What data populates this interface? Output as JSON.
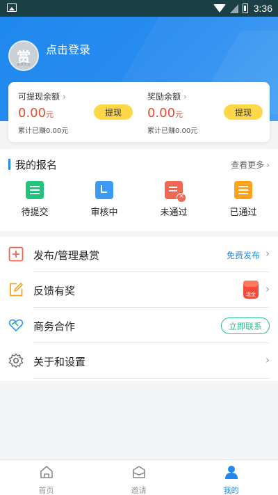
{
  "status_bar": {
    "time": "3:36"
  },
  "profile": {
    "avatar_text": "赏",
    "avatar_caption": "悬赏大全",
    "login_text": "点击登录"
  },
  "balances": [
    {
      "label": "可提现余额",
      "amount": "0.00",
      "unit": "元",
      "earned": "累计已赚0.00元",
      "button": "提现"
    },
    {
      "label": "奖励余额",
      "amount": "0.00",
      "unit": "元",
      "earned": "累计已赚0.00元",
      "button": "提现"
    }
  ],
  "signup": {
    "title": "我的报名",
    "more": "查看更多",
    "items": [
      {
        "label": "待提交"
      },
      {
        "label": "审核中"
      },
      {
        "label": "未通过"
      },
      {
        "label": "已通过"
      }
    ]
  },
  "menu": [
    {
      "label": "发布/管理悬赏",
      "right": "免费发布"
    },
    {
      "label": "反馈有奖",
      "badge": "现金"
    },
    {
      "label": "商务合作",
      "right": "立即联系"
    },
    {
      "label": "关于和设置"
    }
  ],
  "nav": [
    {
      "label": "首页"
    },
    {
      "label": "邀请"
    },
    {
      "label": "我的",
      "active": true
    }
  ],
  "colors": {
    "primary": "#1e88ee",
    "accent_yellow": "#ffd84a",
    "amount_red": "#f04a2e",
    "contact_green": "#27c08a"
  }
}
